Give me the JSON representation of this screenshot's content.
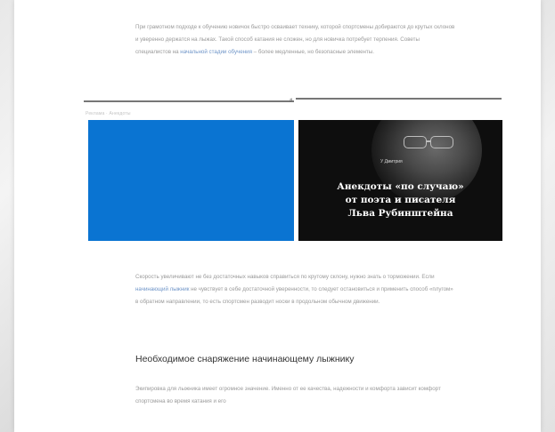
{
  "article": {
    "intro_paragraph": {
      "text_before_link": "При грамотном подходе к обучению новичок быстро осваивает технику, которой спортсмены добираются до крутых склонов и уверенно держатся на лыжах. Такой способ катания не сложен, но для новичка потребует терпения. Советы специалистов на",
      "link_text": "начальной стадии обучения",
      "text_after_link": "– более медленные, но безопасные элементы."
    },
    "caption": "Реклама · Анекдоты",
    "cards": {
      "promo": {
        "badge": "У Дмитрия",
        "title_lines": [
          "Анекдоты «по случаю»",
          "от поэта и писателя",
          "Льва Рубинштейна"
        ]
      }
    },
    "second_paragraph": {
      "text_before_link": "Скорость увеличивают не без достаточных навыков справиться по крутому склону, нужно знать о торможении. Если",
      "link_text": "начинающий лыжник",
      "text_after_link": "не чувствует в себе достаточной уверенности, то следует остановиться и применить способ «плугом» в обратном направлении, то есть спортсмен разводит носки в продольном обычном движении."
    },
    "section_heading": "Необходимое снаряжение начинающему лыжнику",
    "third_paragraph": "Экипировка для лыжника имеет огромное значение. Именно от ее качества, надежности и комфорта зависит комфорт спортсмена во время катания и его"
  },
  "colors": {
    "accent_blue": "#0a74d2",
    "link": "#6f95c8",
    "body_text": "#9a9a9a",
    "heading": "#333333"
  }
}
